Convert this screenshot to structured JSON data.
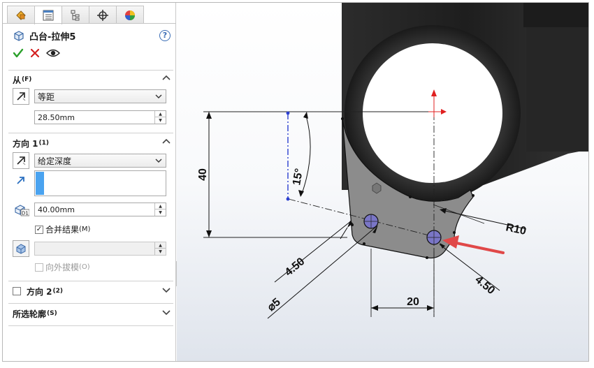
{
  "feature": {
    "title": "凸台-拉伸5",
    "help_icon": "?"
  },
  "tabs": [
    "feature-manager-icon",
    "property-manager-icon",
    "configuration-manager-icon",
    "dim-xpert-icon",
    "display-manager-icon"
  ],
  "from_section": {
    "label": "从",
    "shortcut": "(F)",
    "type_value": "等距",
    "offset_value": "28.50mm"
  },
  "direction1": {
    "label": "方向 1",
    "shortcut": "(1)",
    "end_condition": "给定深度",
    "depth_value": "40.00mm",
    "depth_tag": "D1",
    "merge_label": "合并结果",
    "merge_shortcut": "(M)",
    "merge_checked": true,
    "draft_value": "",
    "draft_outward_label": "向外拔模",
    "draft_outward_shortcut": "(O)",
    "draft_outward_checked": false
  },
  "direction2": {
    "label": "方向 2",
    "shortcut": "(2)",
    "checked": false
  },
  "selected_contours": {
    "label": "所选轮廓",
    "shortcut": "(S)"
  },
  "sketch_dims": {
    "height": "40",
    "angle": "15°",
    "radius": "R10",
    "offset_left": "4.50",
    "offset_right": "4.50",
    "diameter": "5",
    "diameter_symbol": "⌀",
    "spacing": "20"
  },
  "colors": {
    "accent_blue": "#4aa3f0",
    "check_green": "#2aa02a",
    "cancel_red": "#d42020",
    "sketch_fill": "#8c8c8c",
    "part_dark": "#262626",
    "pointer_arrow": "#e04848"
  }
}
